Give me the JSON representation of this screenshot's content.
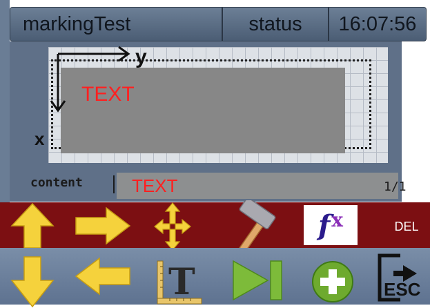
{
  "titlebar": {
    "app_name": "markingTest",
    "status": "status",
    "time": "16:07:56"
  },
  "canvas": {
    "text_object": "TEXT",
    "axis_y_label": "y",
    "axis_x_label": "x"
  },
  "content": {
    "label": "content",
    "value": "TEXT",
    "page": "1/1"
  },
  "toolbar": {
    "row1": [
      {
        "name": "arrow-up-icon"
      },
      {
        "name": "arrow-right-icon"
      },
      {
        "name": "move-icon"
      },
      {
        "name": "hammer-icon"
      },
      {
        "name": "function-icon",
        "text_f": "f",
        "text_x": "x"
      },
      {
        "name": "delete-button",
        "label": "DEL"
      }
    ],
    "row2": [
      {
        "name": "arrow-down-icon"
      },
      {
        "name": "arrow-left-icon"
      },
      {
        "name": "text-tool-icon",
        "letter": "T"
      },
      {
        "name": "play-next-icon"
      },
      {
        "name": "add-icon"
      },
      {
        "name": "exit-icon",
        "label": "ESC"
      }
    ]
  },
  "colors": {
    "accent_red": "#7c0f12",
    "arrow_yellow": "#f5d23c",
    "text_red": "#ff2020"
  }
}
